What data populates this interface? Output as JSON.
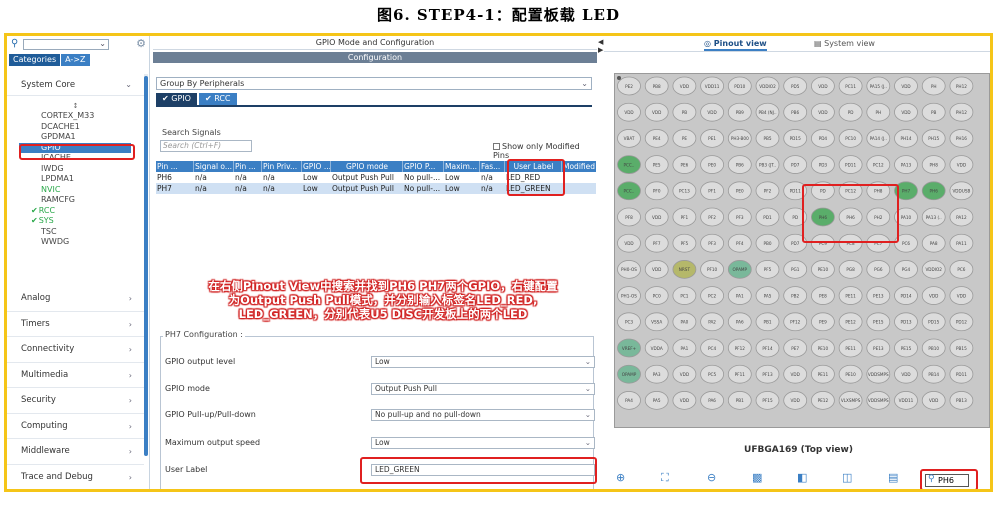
{
  "caption": "图6.    STEP4-1：配置板载 LED",
  "left": {
    "tabs": [
      "Categories",
      "A->Z"
    ],
    "system_core": "System Core",
    "items": [
      {
        "label": "CORTEX_M33",
        "state": ""
      },
      {
        "label": "DCACHE1",
        "state": ""
      },
      {
        "label": "GPDMA1",
        "state": ""
      },
      {
        "label": "GPIO",
        "state": "selected"
      },
      {
        "label": "ICACHE",
        "state": ""
      },
      {
        "label": "IWDG",
        "state": ""
      },
      {
        "label": "LPDMA1",
        "state": ""
      },
      {
        "label": "NVIC",
        "state": "green"
      },
      {
        "label": "RAMCFG",
        "state": ""
      },
      {
        "label": "RCC",
        "state": "checked"
      },
      {
        "label": "SYS",
        "state": "checked"
      },
      {
        "label": "TSC",
        "state": ""
      },
      {
        "label": "WWDG",
        "state": ""
      }
    ],
    "categories": [
      "Analog",
      "Timers",
      "Connectivity",
      "Multimedia",
      "Security",
      "Computing",
      "Middleware",
      "Trace and Debug"
    ]
  },
  "mid": {
    "title": "GPIO Mode and Configuration",
    "subtitle": "Configuration",
    "group_select": "Group By Peripherals",
    "mode_tabs": [
      "GPIO",
      "RCC"
    ],
    "search_label": "Search Signals",
    "search_placeholder": "Search (Ctrl+F)",
    "show_modified": "Show only Modified Pins",
    "columns": [
      "Pin ...",
      "Signal o...",
      "Pin ...",
      "Pin Priv...",
      "GPIO ...",
      "GPIO mode",
      "GPIO P...",
      "Maxim...",
      "Fas...",
      "User Label",
      "Modified"
    ],
    "rows": [
      [
        "PH6",
        "n/a",
        "n/a",
        "n/a",
        "Low",
        "Output Push Pull",
        "No pull-...",
        "Low",
        "n/a",
        "LED_RED",
        "✓"
      ],
      [
        "PH7",
        "n/a",
        "n/a",
        "n/a",
        "Low",
        "Output Push Pull",
        "No pull-...",
        "Low",
        "n/a",
        "LED_GREEN",
        "✓"
      ]
    ],
    "annotation": [
      "在右侧Pinout View中搜索并找到PH6 PH7两个GPIO，右键配置",
      "为Output Push Pull模式，并分别输入标签名LED_RED,",
      "LED_GREEN，分别代表U5 DISC开发板上的两个LED"
    ],
    "config_title": "PH7 Configuration :",
    "config": [
      {
        "label": "GPIO output level",
        "value": "Low"
      },
      {
        "label": "GPIO mode",
        "value": "Output Push Pull"
      },
      {
        "label": "GPIO Pull-up/Pull-down",
        "value": "No pull-up and no pull-down"
      },
      {
        "label": "Maximum output speed",
        "value": "Low"
      },
      {
        "label": "User Label",
        "value": "LED_GREEN"
      }
    ]
  },
  "right": {
    "tab_pinout": "Pinout view",
    "tab_system": "System view",
    "chip_name": "UFBGA169 (Top view)",
    "find_value": "PH6",
    "pin_labels": [
      [
        "PE2",
        "PB8",
        "VDD",
        "VDD11",
        "PD10",
        "VDDIO2",
        "PD5",
        "VDD",
        "PC11",
        "PA15 (J..",
        "VDD",
        "PH",
        "PH12"
      ],
      [
        "VDD",
        "VDD",
        "PB",
        "VDD",
        "PB9",
        "PB4 (NJ..",
        "PB6",
        "VDD",
        "PD",
        "PH",
        "VDD",
        "PB",
        "PH12"
      ],
      [
        "VBAT",
        "PE4",
        "PE",
        "PE1",
        "PH3-B00",
        "PB5",
        "PD15",
        "PD4",
        "PC10",
        "PA14 (J..",
        "PH14",
        "PH15",
        "PH16"
      ],
      [
        "PCC..",
        "PE5",
        "PE6",
        "PE0",
        "PB6",
        "PB3 (JT..",
        "PD7",
        "PD3",
        "PD11",
        "PC12",
        "PA13",
        "PH8",
        "VDD"
      ],
      [
        "PCC..",
        "PF0",
        "PC13",
        "PF1",
        "PE0",
        "PF2",
        "PD11",
        "PD",
        "PC12",
        "PH8",
        "PH7",
        "PH6",
        "VDDUSB"
      ],
      [
        "PF8",
        "VDD",
        "PF1",
        "PF2",
        "PF3",
        "PD1",
        "PD",
        "PH6",
        "PH6",
        "PH2",
        "PA10",
        "PA13 (..",
        "PA12"
      ],
      [
        "VDD",
        "PF7",
        "PF5",
        "PF3",
        "PF4",
        "PB0",
        "PD7",
        "PC9",
        "PC8",
        "PC7",
        "PC6",
        "PA8",
        "PA11"
      ],
      [
        "PH0-OS",
        "VDD",
        "NRST",
        "PF10",
        "OPAMP",
        "PF5",
        "PG1",
        "PE10",
        "PG8",
        "PG6",
        "PG4",
        "VDDIO2",
        "PC6"
      ],
      [
        "PH1-OS",
        "PC0",
        "PC1",
        "PC2",
        "PA1",
        "PA5",
        "PB2",
        "PE8",
        "PE11",
        "PE13",
        "PD14",
        "VDD",
        "VDD"
      ],
      [
        "PC3",
        "VSSA",
        "PA0",
        "PA2",
        "PA6",
        "PB1",
        "PF12",
        "PE9",
        "PE12",
        "PE15",
        "PD13",
        "PD15",
        "PD12"
      ],
      [
        "VREF+",
        "VDDA",
        "PA1",
        "PC4",
        "PF12",
        "PF14",
        "PE7",
        "PE10",
        "PE11",
        "PE13",
        "PE15",
        "PB10",
        "PB15"
      ],
      [
        "OPAMP",
        "PA3",
        "VDD",
        "PC5",
        "PF11",
        "PF13",
        "VDD",
        "PE11",
        "PE10",
        "VDDSMPS",
        "VDD",
        "PB14",
        "PD11"
      ],
      [
        "PA4",
        "PA5",
        "VDD",
        "PA6",
        "PB1",
        "PF15",
        "VDD",
        "PE12",
        "VLXSMPS",
        "VDDSMPS",
        "VDD11",
        "VDD",
        "PB13"
      ]
    ],
    "pin_colors": {
      "green": "#5aad6a",
      "olive": "#b5b86a",
      "teal": "#79b89a",
      "pin": "#dcdcdc"
    }
  }
}
